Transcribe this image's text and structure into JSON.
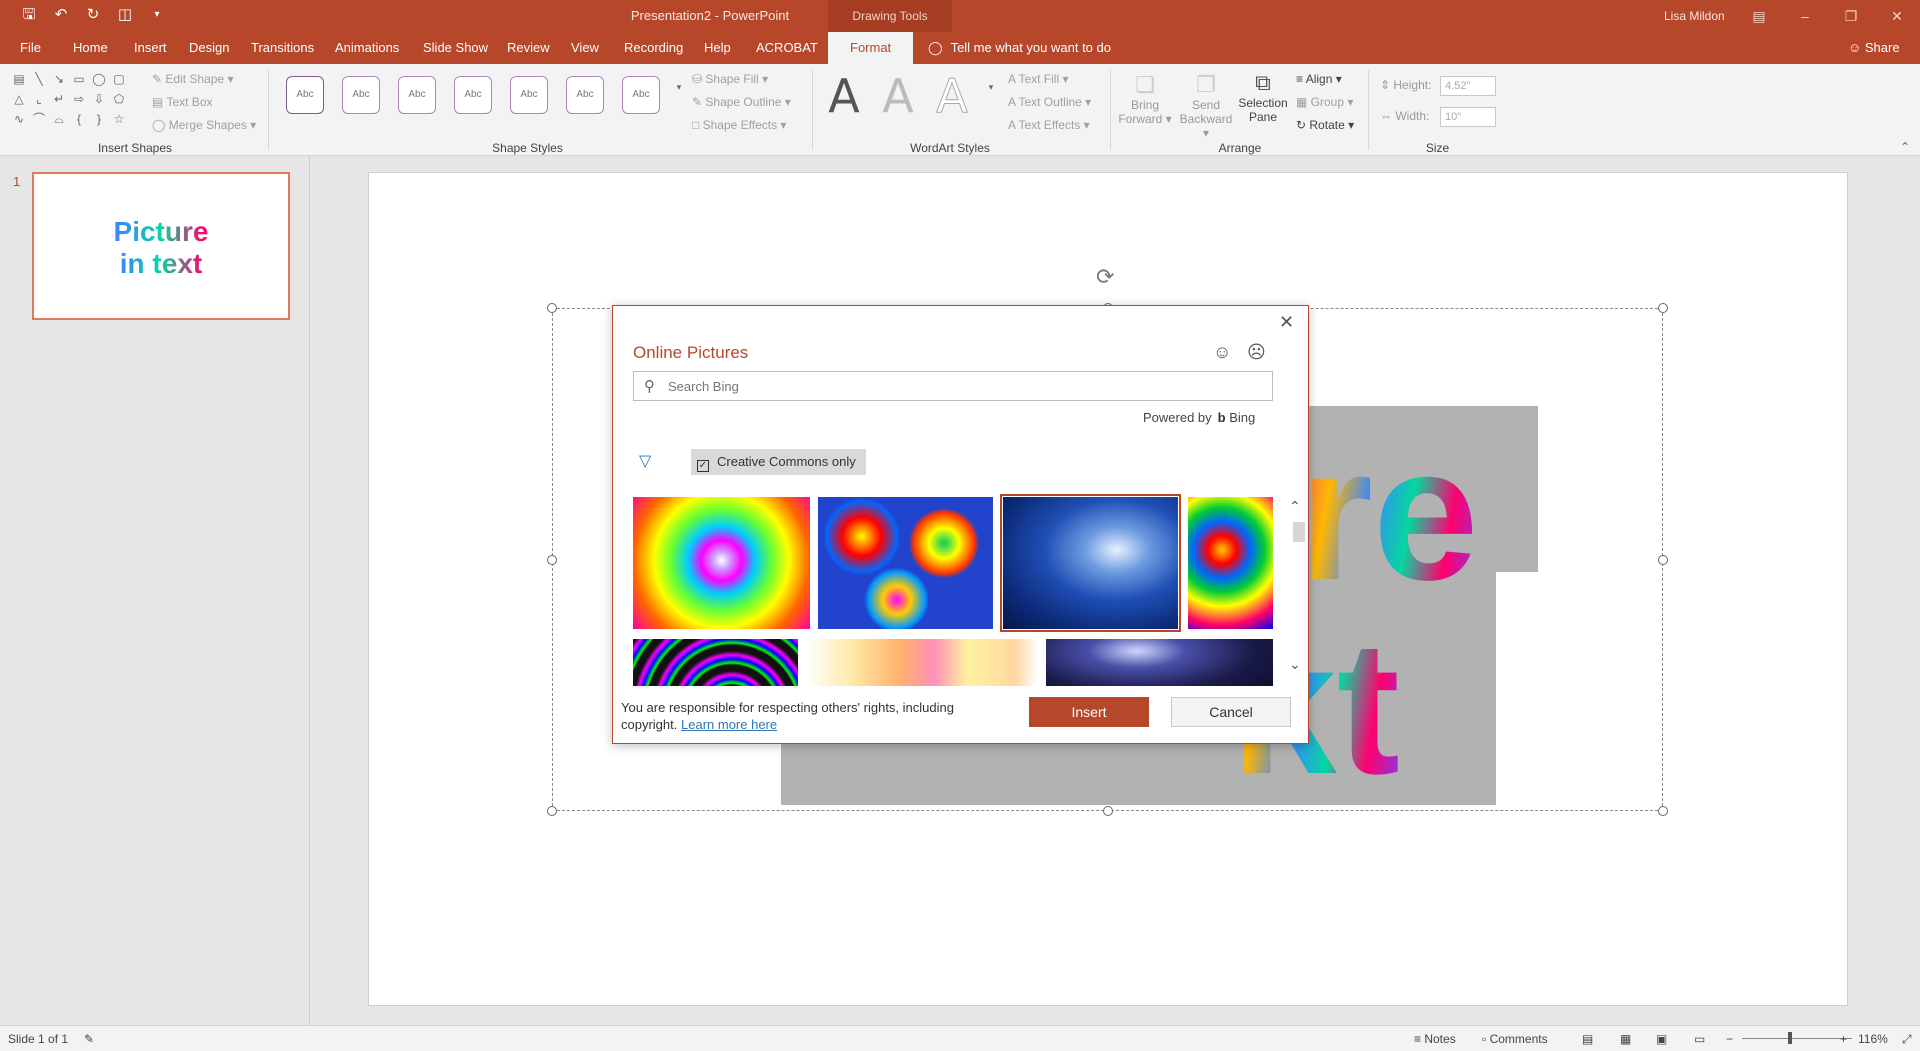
{
  "titlebar": {
    "doc_title": "Presentation2  -  PowerPoint",
    "contextual": "Drawing Tools",
    "user": "Lisa Mildon",
    "qat_icons": [
      "save-icon",
      "undo-icon",
      "redo-icon",
      "start-from-beginning-icon",
      "customize-qat-icon"
    ]
  },
  "tabs": [
    "File",
    "Home",
    "Insert",
    "Design",
    "Transitions",
    "Animations",
    "Slide Show",
    "Review",
    "View",
    "Recording",
    "Help",
    "ACROBAT",
    "Format"
  ],
  "active_tab": "Format",
  "tellme": "Tell me what you want to do",
  "share": "Share",
  "ribbon": {
    "insert_shapes": {
      "label": "Insert Shapes",
      "edit_shape": "Edit Shape",
      "text_box": "Text Box",
      "merge_shapes": "Merge Shapes"
    },
    "shape_styles": {
      "label": "Shape Styles",
      "thumb_text": "Abc",
      "shape_fill": "Shape Fill",
      "shape_outline": "Shape Outline",
      "shape_effects": "Shape Effects"
    },
    "wordart_styles": {
      "label": "WordArt Styles",
      "glyph": "A",
      "text_fill": "Text Fill",
      "text_outline": "Text Outline",
      "text_effects": "Text Effects"
    },
    "arrange": {
      "label": "Arrange",
      "bring_forward_1": "Bring",
      "bring_forward_2": "Forward",
      "send_backward_1": "Send",
      "send_backward_2": "Backward",
      "selection_pane_1": "Selection",
      "selection_pane_2": "Pane",
      "align": "Align",
      "group": "Group",
      "rotate": "Rotate"
    },
    "size": {
      "label": "Size",
      "height_label": "Height:",
      "height_value": "4.52\"",
      "width_label": "Width:",
      "width_value": "10\""
    }
  },
  "slide_panel": {
    "number": "1",
    "thumb_line1": "Picture",
    "thumb_line2": "in text"
  },
  "slide": {
    "fragment_top": "re",
    "fragment_bottom": "kt"
  },
  "dialog": {
    "title": "Online Pictures",
    "search_placeholder": "Search Bing",
    "powered_by": "Powered by",
    "bing": "Bing",
    "creative_commons": "Creative Commons only",
    "creative_commons_checked": true,
    "disclaimer": "You are responsible for respecting others' rights, including copyright.",
    "learn_more": "Learn more here",
    "insert": "Insert",
    "cancel": "Cancel"
  },
  "status": {
    "slide_of": "Slide 1 of 1",
    "notes": "Notes",
    "comments": "Comments",
    "zoom": "116%"
  }
}
